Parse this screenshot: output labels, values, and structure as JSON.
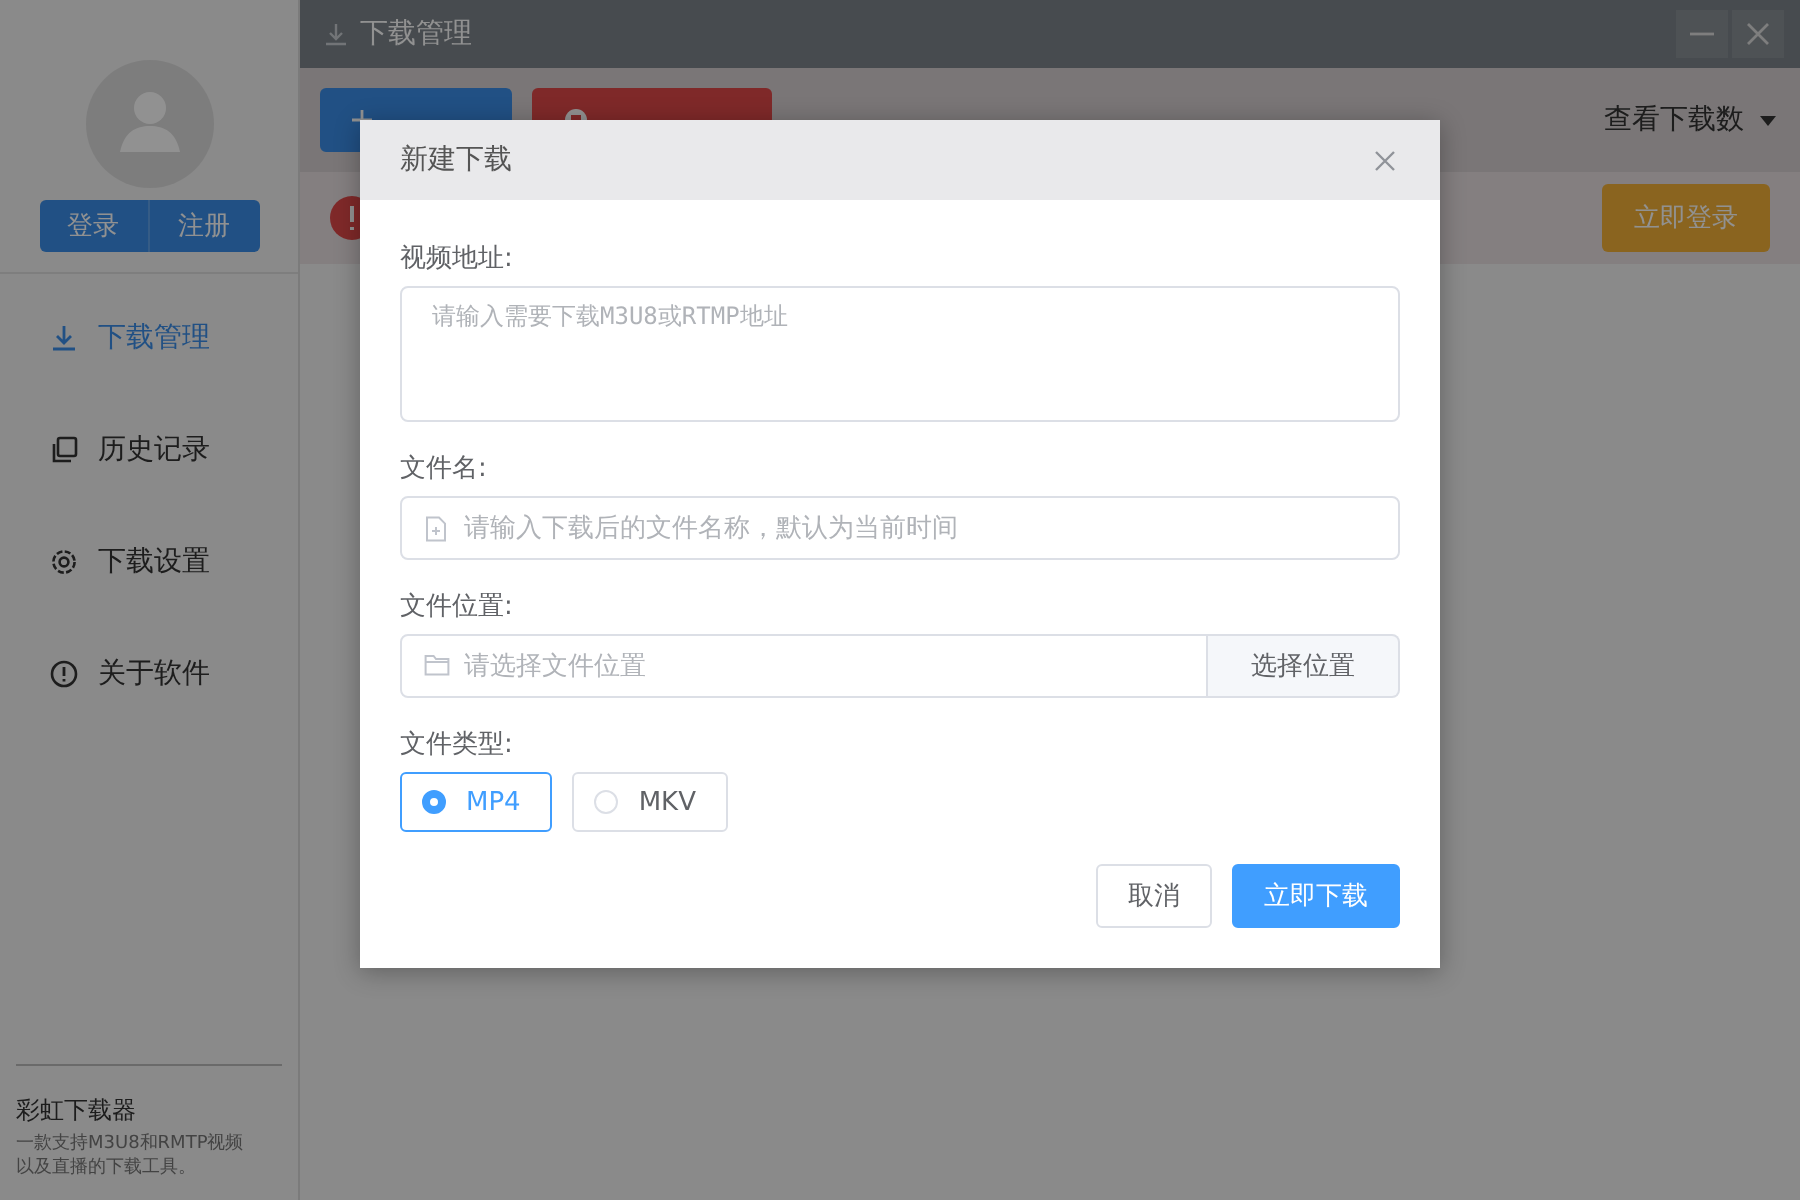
{
  "sidebar": {
    "buttons": [
      "登录",
      "注册"
    ],
    "nav": [
      {
        "label": "下载管理",
        "selected": true,
        "kind": "download"
      },
      {
        "label": "历史记录",
        "selected": false,
        "kind": "history"
      },
      {
        "label": "下载设置",
        "selected": false,
        "kind": "settings"
      },
      {
        "label": "关于软件",
        "selected": false,
        "kind": "info"
      }
    ],
    "footer": {
      "title": "彩虹下载器",
      "lines": [
        "一款支持M3U8和RMTP视频",
        "以及直播的下载工具。"
      ]
    }
  },
  "titlebar": {
    "title": "下载管理"
  },
  "toolbar": {
    "buttons": [
      {
        "kind": "primary"
      },
      {
        "kind": "danger"
      }
    ],
    "dropdown": "查看下载数"
  },
  "notice": {
    "button": "立即登录"
  },
  "dialog": {
    "title": "新建下载",
    "fields": [
      {
        "label": "视频地址:",
        "kind": "textarea",
        "placeholder": "请输入需要下载M3U8或RTMP地址"
      },
      {
        "label": "文件名:",
        "kind": "file",
        "placeholder": "请输入下载后的文件名称，默认为当前时间"
      },
      {
        "label": "文件位置:",
        "kind": "folder",
        "placeholder": "请选择文件位置",
        "button": "选择位置"
      }
    ],
    "file_type": {
      "label": "文件类型:",
      "options": [
        {
          "label": "MP4",
          "selected": true
        },
        {
          "label": "MKV",
          "selected": false
        }
      ]
    },
    "buttons": [
      {
        "label": "取消",
        "kind": "default"
      },
      {
        "label": "立即下载",
        "kind": "primary"
      }
    ]
  }
}
